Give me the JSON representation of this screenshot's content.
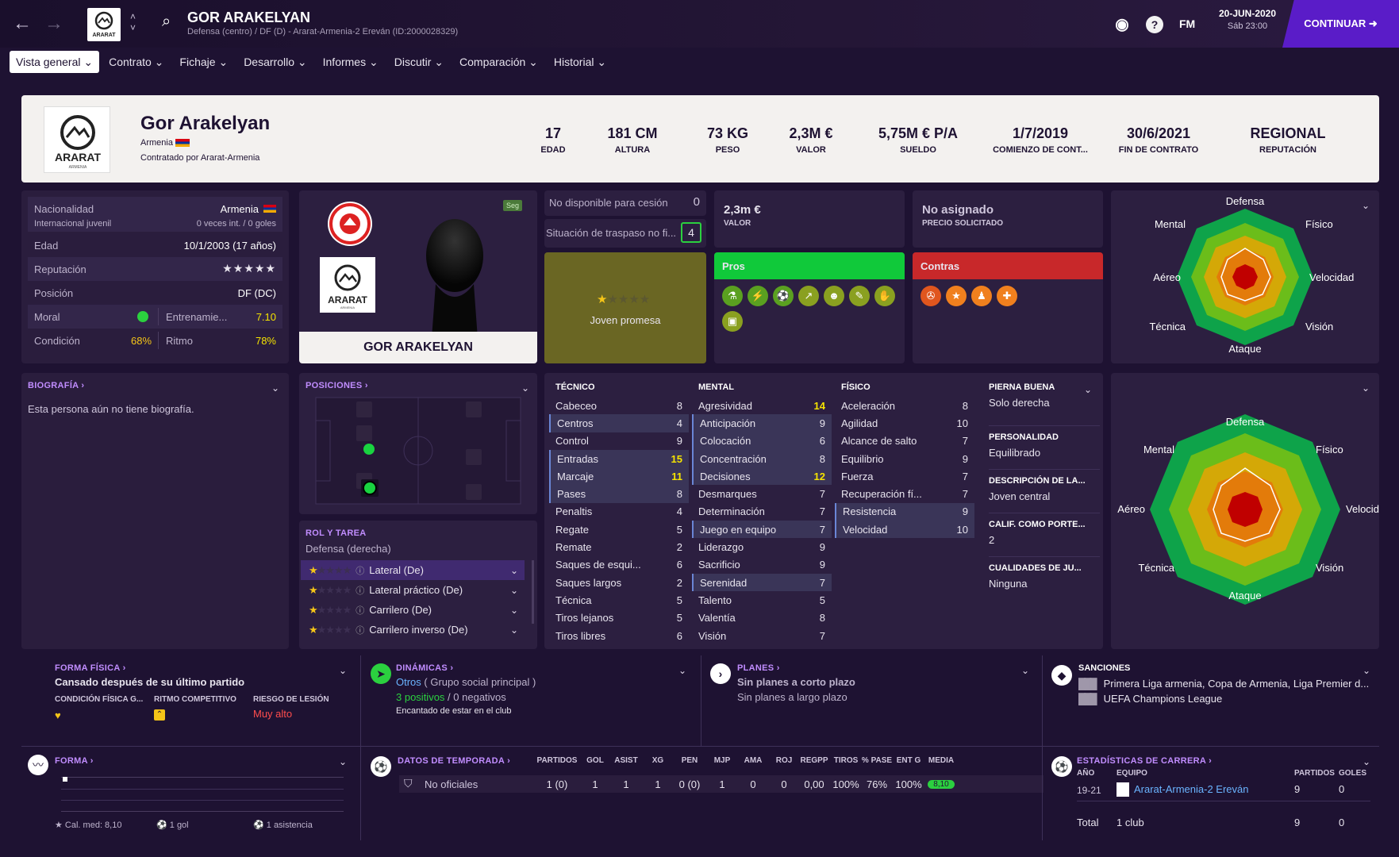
{
  "top": {
    "player_title": "GOR ARAKELYAN",
    "player_sub": "Defensa (centro) / DF (D) - Ararat-Armenia-2 Ereván (ID:2000028329)",
    "fm": "FM",
    "date": "20-JUN-2020",
    "time": "Sáb 23:00",
    "continue": "CONTINUAR",
    "club_short": "ARARAT"
  },
  "menu": [
    "Vista general",
    "Contrato",
    "Fichaje",
    "Desarrollo",
    "Informes",
    "Discutir",
    "Comparación",
    "Historial"
  ],
  "header": {
    "name": "Gor Arakelyan",
    "nationality": "Armenia",
    "contracted": "Contratado por Ararat-Armenia",
    "logo_text": "ARARAT",
    "logo_sub": "ARMENIA",
    "stats": [
      {
        "v": "17",
        "l": "EDAD"
      },
      {
        "v": "181 CM",
        "l": "ALTURA"
      },
      {
        "v": "73 KG",
        "l": "PESO"
      },
      {
        "v": "2,3M €",
        "l": "VALOR"
      },
      {
        "v": "5,75M € P/A",
        "l": "SUELDO"
      },
      {
        "v": "1/7/2019",
        "l": "COMIENZO DE CONT..."
      },
      {
        "v": "30/6/2021",
        "l": "FIN DE CONTRATO"
      },
      {
        "v": "REGIONAL",
        "l": "REPUTACIÓN"
      }
    ]
  },
  "info": {
    "nac_l": "Nacionalidad",
    "nac_v": "Armenia",
    "intl_l": "Internacional juvenil",
    "intl_v": "0 veces int. / 0 goles",
    "edad_l": "Edad",
    "edad_v": "10/1/2003 (17 años)",
    "rep_l": "Reputación",
    "pos_l": "Posición",
    "pos_v": "DF (DC)",
    "moral_l": "Moral",
    "entr_l": "Entrenamie...",
    "entr_v": "7.10",
    "cond_l": "Condición",
    "cond_v": "68%",
    "ritmo_l": "Ritmo",
    "ritmo_v": "78%"
  },
  "photo": {
    "name": "GOR ARAKELYAN",
    "badge": "Seg",
    "logo_text": "ARARAT",
    "logo_sub": "ARMENIA"
  },
  "transfer": {
    "loan_l": "No disponible para cesión",
    "loan_v": "0",
    "status_l": "Situación de traspaso no fi...",
    "status_v": "4",
    "value_v": "2,3m €",
    "value_l": "VALOR",
    "asking_v": "No asignado",
    "asking_l": "PRECIO SOLICITADO",
    "prospect": "Joven promesa",
    "prospect_stars": 1
  },
  "pros": {
    "title": "Pros",
    "icons": [
      "flask-icon",
      "boot-icon",
      "ball-icon",
      "trend-icon",
      "head-icon",
      "pencil-icon",
      "handshake-icon",
      "money-icon"
    ]
  },
  "contras": {
    "title": "Contras",
    "icons": [
      "wrench-icon",
      "star-icon",
      "foot-icon",
      "bandage-icon"
    ]
  },
  "radar1": {
    "labels": [
      "Defensa",
      "Físico",
      "Velocidad",
      "Visión",
      "Ataque",
      "Técnica",
      "Aéreo",
      "Mental"
    ]
  },
  "radar2": {
    "labels": [
      "Defensa",
      "Físico",
      "Velocidad",
      "Visión",
      "Ataque",
      "Técnica",
      "Aéreo",
      "Mental"
    ]
  },
  "bio": {
    "title": "BIOGRAFÍA ›",
    "text": "Esta persona aún no tiene biografía."
  },
  "positions": {
    "title": "POSICIONES ›"
  },
  "role": {
    "title": "ROL Y TAREA",
    "subtitle": "Defensa (derecha)",
    "items": [
      {
        "name": "Lateral (De)",
        "stars": 1
      },
      {
        "name": "Lateral práctico (De)",
        "stars": 1
      },
      {
        "name": "Carrilero (De)",
        "stars": 1
      },
      {
        "name": "Carrilero inverso (De)",
        "stars": 1
      }
    ]
  },
  "attrs": {
    "tecnico": {
      "title": "TÉCNICO",
      "rows": [
        [
          "Cabeceo",
          "8",
          0,
          0
        ],
        [
          "Centros",
          "4",
          1,
          0
        ],
        [
          "Control",
          "9",
          0,
          0
        ],
        [
          "Entradas",
          "15",
          1,
          1
        ],
        [
          "Marcaje",
          "11",
          1,
          1
        ],
        [
          "Pases",
          "8",
          1,
          0
        ],
        [
          "Penaltis",
          "4",
          0,
          0
        ],
        [
          "Regate",
          "5",
          0,
          0
        ],
        [
          "Remate",
          "2",
          0,
          0
        ],
        [
          "Saques de esqui...",
          "6",
          0,
          0
        ],
        [
          "Saques largos",
          "2",
          0,
          0
        ],
        [
          "Técnica",
          "5",
          0,
          0
        ],
        [
          "Tiros lejanos",
          "5",
          0,
          0
        ],
        [
          "Tiros libres",
          "6",
          0,
          0
        ]
      ]
    },
    "mental": {
      "title": "MENTAL",
      "rows": [
        [
          "Agresividad",
          "14",
          0,
          1
        ],
        [
          "Anticipación",
          "9",
          1,
          0
        ],
        [
          "Colocación",
          "6",
          1,
          0
        ],
        [
          "Concentración",
          "8",
          1,
          0
        ],
        [
          "Decisiones",
          "12",
          1,
          1
        ],
        [
          "Desmarques",
          "7",
          0,
          0
        ],
        [
          "Determinación",
          "7",
          0,
          0
        ],
        [
          "Juego en equipo",
          "7",
          1,
          0
        ],
        [
          "Liderazgo",
          "9",
          0,
          0
        ],
        [
          "Sacrificio",
          "9",
          0,
          0
        ],
        [
          "Serenidad",
          "7",
          1,
          0
        ],
        [
          "Talento",
          "5",
          0,
          0
        ],
        [
          "Valentía",
          "8",
          0,
          0
        ],
        [
          "Visión",
          "7",
          0,
          0
        ]
      ]
    },
    "fisico": {
      "title": "FÍSICO",
      "rows": [
        [
          "Aceleración",
          "8",
          0,
          0
        ],
        [
          "Agilidad",
          "10",
          0,
          0
        ],
        [
          "Alcance de salto",
          "7",
          0,
          0
        ],
        [
          "Equilibrio",
          "9",
          0,
          0
        ],
        [
          "Fuerza",
          "7",
          0,
          0
        ],
        [
          "Recuperación fí...",
          "7",
          0,
          0
        ],
        [
          "Resistencia",
          "9",
          1,
          0
        ],
        [
          "Velocidad",
          "10",
          1,
          0
        ]
      ]
    }
  },
  "extra": [
    {
      "l": "PIERNA BUENA",
      "v": "Solo derecha"
    },
    {
      "l": "PERSONALIDAD",
      "v": "Equilibrado"
    },
    {
      "l": "DESCRIPCIÓN DE LA...",
      "v": "Joven central"
    },
    {
      "l": "CALIF. COMO PORTE...",
      "v": "2"
    },
    {
      "l": "CUALIDADES DE JU...",
      "v": "Ninguna"
    }
  ],
  "fitness": {
    "title": "FORMA FÍSICA ›",
    "headline": "Cansado después de su último partido",
    "c1": "CONDICIÓN FÍSICA G...",
    "c2": "RITMO COMPETITIVO",
    "c3": "RIESGO DE LESIÓN",
    "c3v": "Muy alto"
  },
  "dynamics": {
    "title": "DINÁMICAS ›",
    "l1a": "Otros",
    "l1b": "( Grupo social principal )",
    "pos": "3 positivos",
    "sep": "/",
    "neg": "0 negativos",
    "happy": "Encantado de estar en el club"
  },
  "plans": {
    "title": "PLANES ›",
    "short": "Sin planes a corto plazo",
    "long": "Sin planes a largo plazo"
  },
  "sanctions": {
    "title": "SANCIONES",
    "l1": "Primera Liga armenia, Copa de Armenia, Liga Premier d...",
    "l2": "UEFA Champions League"
  },
  "form": {
    "title": "FORMA ›",
    "avg": "Cal. med: 8,10",
    "goals": "1 gol",
    "assists": "1 asistencia"
  },
  "season": {
    "title": "DATOS DE TEMPORADA ›",
    "cols": [
      "PARTIDOS",
      "GOL",
      "ASIST",
      "XG",
      "PEN",
      "MJP",
      "AMA",
      "ROJ",
      "REGPP",
      "TIROS",
      "% PASE",
      "ENT G",
      "MEDIA"
    ],
    "row_label": "No oficiales",
    "row": [
      "1 (0)",
      "1",
      "1",
      "1",
      "0 (0)",
      "1",
      "0",
      "0",
      "0,00",
      "100%",
      "76%",
      "100%",
      "8,10"
    ]
  },
  "career": {
    "title": "ESTADÍSTICAS DE CARRERA ›",
    "h_year": "AÑO",
    "h_team": "EQUIPO",
    "h_apps": "PARTIDOS",
    "h_goals": "GOLES",
    "year": "19-21",
    "team": "Ararat-Armenia-2 Ereván",
    "apps": "9",
    "goals": "0",
    "total_l": "Total",
    "total_clubs": "1 club",
    "total_apps": "9",
    "total_goals": "0"
  }
}
